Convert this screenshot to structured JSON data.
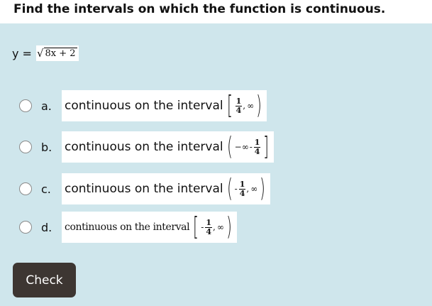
{
  "question": {
    "title": "Find the intervals on which the function is continuous."
  },
  "equation": {
    "lhs": "y =",
    "radical": "√",
    "radicand": "8x + 2"
  },
  "options": [
    {
      "letter": "a.",
      "text": "continuous on the interval",
      "open": "[",
      "sign": "",
      "num": "1",
      "den": "4",
      "comma": ",",
      "right": "∞",
      "close": ")"
    },
    {
      "letter": "b.",
      "text": "continuous on the interval",
      "open": "(",
      "left": "−∞",
      "dash": "-",
      "num": "1",
      "den": "4",
      "close": "]"
    },
    {
      "letter": "c.",
      "text": "continuous on the interval",
      "open": "(",
      "sign": "-",
      "num": "1",
      "den": "4",
      "comma": ",",
      "right": "∞",
      "close": ")"
    },
    {
      "letter": "d.",
      "text": "continuous on the interval",
      "open": "[",
      "sign": "-",
      "num": "1",
      "den": "4",
      "comma": ",",
      "right": "∞",
      "close": ")"
    }
  ],
  "check_button": {
    "label": "Check"
  },
  "colors": {
    "background": "#cfe6ec",
    "button": "#3d3632"
  }
}
